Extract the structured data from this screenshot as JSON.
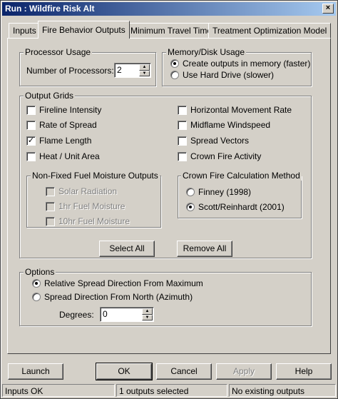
{
  "window": {
    "title": "Run : Wildfire Risk Alt",
    "close_label": "×"
  },
  "tabs": [
    {
      "label": "Inputs",
      "active": false
    },
    {
      "label": "Fire Behavior Outputs",
      "active": true
    },
    {
      "label": "Minimum Travel Time",
      "active": false
    },
    {
      "label": "Treatment Optimization Model",
      "active": false
    }
  ],
  "processor": {
    "legend": "Processor Usage",
    "label": "Number of Processors:",
    "value": "2"
  },
  "memory": {
    "legend": "Memory/Disk Usage",
    "options": [
      {
        "label": "Create outputs in memory (faster)",
        "selected": true
      },
      {
        "label": "Use Hard Drive (slower)",
        "selected": false
      }
    ]
  },
  "output_grids": {
    "legend": "Output Grids",
    "left": [
      {
        "label": "Fireline Intensity",
        "checked": false
      },
      {
        "label": "Rate of Spread",
        "checked": false
      },
      {
        "label": "Flame Length",
        "checked": true
      },
      {
        "label": "Heat / Unit Area",
        "checked": false
      }
    ],
    "right": [
      {
        "label": "Horizontal Movement Rate",
        "checked": false
      },
      {
        "label": "Midflame Windspeed",
        "checked": false
      },
      {
        "label": "Spread Vectors",
        "checked": false
      },
      {
        "label": "Crown Fire Activity",
        "checked": false
      }
    ],
    "check_mark": "✓"
  },
  "moisture": {
    "legend": "Non-Fixed Fuel Moisture Outputs",
    "items": [
      {
        "label": "Solar Radiation",
        "checked": false
      },
      {
        "label": "1hr Fuel Moisture",
        "checked": false
      },
      {
        "label": "10hr Fuel Moisture",
        "checked": false
      }
    ]
  },
  "crown": {
    "legend": "Crown Fire Calculation Method",
    "options": [
      {
        "label": "Finney (1998)",
        "selected": false
      },
      {
        "label": "Scott/Reinhardt (2001)",
        "selected": true
      }
    ]
  },
  "buttons": {
    "select_all": "Select All",
    "remove_all": "Remove All"
  },
  "options": {
    "legend": "Options",
    "radios": [
      {
        "label": "Relative Spread Direction From Maximum",
        "selected": true
      },
      {
        "label": "Spread Direction From North (Azimuth)",
        "selected": false
      }
    ],
    "degrees_label": "Degrees:",
    "degrees_value": "0"
  },
  "bottom_buttons": {
    "launch": "Launch",
    "ok": "OK",
    "cancel": "Cancel",
    "apply": "Apply",
    "help": "Help"
  },
  "status": {
    "pane1": "Inputs OK",
    "pane2": "1 outputs selected",
    "pane3": "No existing outputs"
  }
}
